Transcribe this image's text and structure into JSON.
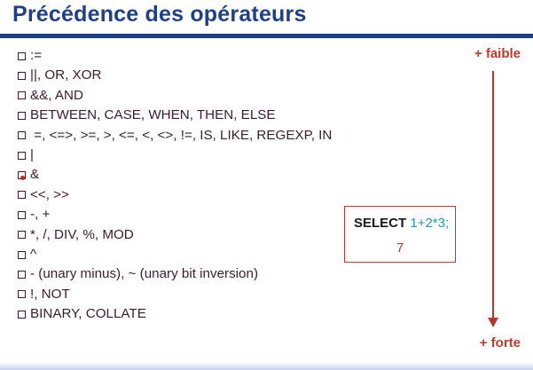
{
  "title": "Précédence des opérateurs",
  "operators": [
    ":=",
    "||, OR, XOR",
    "&&, AND",
    "BETWEEN, CASE, WHEN, THEN, ELSE",
    " =, <=>, >=, >, <=, <, <>, !=, IS, LIKE, REGEXP, IN",
    "|",
    "&",
    "<<, >>",
    "-, +",
    "*, /, DIV, %, MOD",
    "^",
    "- (unary minus), ~ (unary bit inversion)",
    "!, NOT",
    "BINARY, COLLATE"
  ],
  "low_label": "+ faible",
  "high_label": "+ forte",
  "sql": {
    "keyword": "SELECT",
    "expression": "1+2*3;",
    "result": "7"
  },
  "colors": {
    "title": "#1f3f86",
    "text": "#3a1c2c",
    "accent": "#c0392b",
    "expression": "#1a9aa8"
  },
  "icons": {
    "bullet": "checkbox-square-icon",
    "arrow": "arrow-down-icon"
  }
}
